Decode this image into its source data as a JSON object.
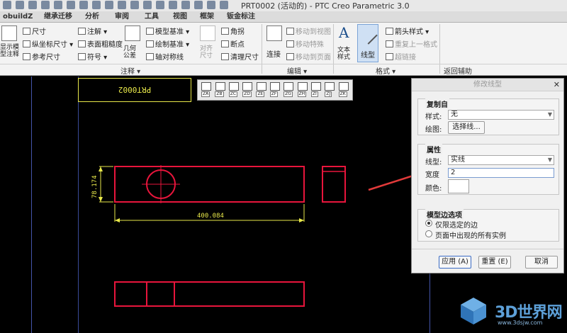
{
  "window": {
    "title": "PRT0002 (活动的) - PTC Creo Parametric 3.0"
  },
  "ribbon_tabs": [
    {
      "label": "obuildZ",
      "key": ""
    },
    {
      "label": "继承迁移",
      "key": ""
    },
    {
      "label": "分析",
      "key": ""
    },
    {
      "label": "审阅",
      "key": ""
    },
    {
      "label": "工具",
      "key": ""
    },
    {
      "label": "视图",
      "key": ""
    },
    {
      "label": "框架",
      "key": ""
    },
    {
      "label": "钣金标注",
      "key": ""
    }
  ],
  "annotate_group": {
    "label": "注释 ▾",
    "show_model_annotations": "显示模型注释",
    "dimension": "尺寸",
    "ordinate_dimension": "纵坐标尺寸 ▾",
    "reference_dimension": "参考尺寸",
    "note": "注解 ▾",
    "surface_finish": "表面粗糙度",
    "symbol": "符号 ▾",
    "geometric_tolerance": "几何公差",
    "model_datum": "模型基准 ▾",
    "draw_datum": "绘制基准 ▾",
    "axis_symmetry": "轴对称线",
    "align_dimension": "对齐尺寸",
    "chamfer": "角拐",
    "break": "断点",
    "cleanup_dimension": "清理尺寸"
  },
  "edit_group": {
    "label": "编辑 ▾",
    "move_to_view": "移动到视图",
    "move_special": "移动特殊",
    "move_to_page": "移动到页面",
    "connect": "连接"
  },
  "format_group": {
    "label": "格式 ▾",
    "text_style": "文本样式",
    "line_style": "线型",
    "arrow_style": "箭头样式 ▾",
    "repeat_last_format": "重复上一格式",
    "hyperlink": "超链接"
  },
  "assist_group": {
    "label": "返回辅助"
  },
  "view_toolbar_keys": [
    "ZA",
    "ZB",
    "ZC",
    "ZD",
    "ZE",
    "ZF",
    "ZG",
    "ZH",
    "ZI",
    "ZJ",
    "ZK"
  ],
  "drawing": {
    "title_block_text": "PRT0002",
    "dim_width": "400.084",
    "dim_height": "78.174"
  },
  "dialog": {
    "title": "修改线型",
    "copy_from": {
      "legend": "复制自",
      "style_label": "样式:",
      "style_value": "无",
      "drawing_label": "绘图:",
      "select_line_button": "选择线..."
    },
    "properties": {
      "legend": "属性",
      "linetype_label": "线型:",
      "linetype_value": "实线",
      "width_label": "宽度",
      "width_value": "2",
      "color_label": "颜色:"
    },
    "model_edge_options": {
      "legend": "模型边选项",
      "option_selected_only": "仅限选定的边",
      "option_all_instances": "页面中出现的所有实例",
      "selected": "option_selected_only"
    },
    "apply_button": "应用 (A)",
    "reset_button": "重置 (E)",
    "cancel_button": "取消"
  },
  "colors": {
    "geometry": "#e8153c",
    "dimension": "#e8e84a",
    "background": "#000000",
    "annotation_arrow": "#e23a3a"
  }
}
